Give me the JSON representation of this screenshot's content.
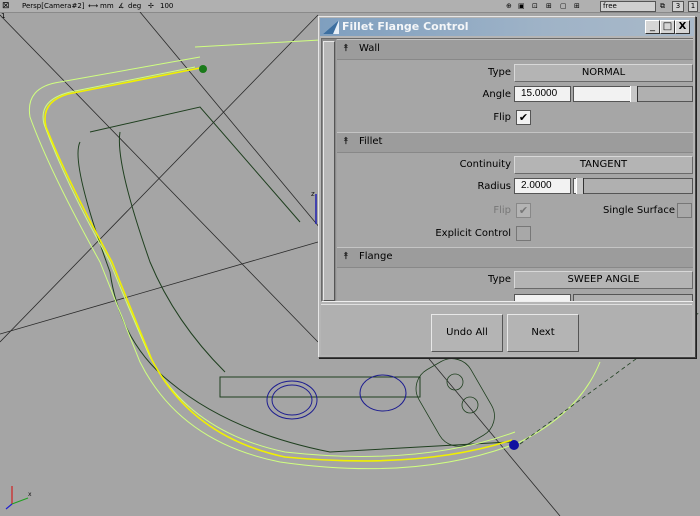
{
  "topbar": {
    "camera": "Persp[Camera#2]",
    "units_mm": "mm",
    "units_deg": "deg",
    "zoom": "100",
    "mode": "free",
    "count": "3",
    "badge": "1"
  },
  "viewport": {
    "axis_z": "z",
    "axis_x": "x"
  },
  "dialog": {
    "title": "Fillet Flange Control",
    "minimize": "_",
    "maximize": "□",
    "close": "X",
    "wall": {
      "header": "Wall",
      "type_label": "Type",
      "type_value": "NORMAL",
      "angle_label": "Angle",
      "angle_value": "15.0000",
      "angle_slider": 0.5,
      "flip_label": "Flip",
      "flip_checked": true
    },
    "fillet": {
      "header": "Fillet",
      "continuity_label": "Continuity",
      "continuity_value": "TANGENT",
      "radius_label": "Radius",
      "radius_value": "2.0000",
      "radius_slider": 0.02,
      "flip_label": "Flip",
      "flip_checked": true,
      "single_surface_label": "Single Surface",
      "explicit_control_label": "Explicit Control"
    },
    "flange": {
      "header": "Flange",
      "type_label": "Type",
      "type_value": "SWEEP ANGLE"
    },
    "buttons": {
      "undo_all": "Undo All",
      "next": "Next"
    }
  },
  "colors": {
    "title_grad_start": "#7f9fbf",
    "viewport_bg": "#a5a5a5",
    "curve_yellow": "#f0f000",
    "curve_green": "#d0ff80",
    "dark_line": "#1f3f1f"
  }
}
